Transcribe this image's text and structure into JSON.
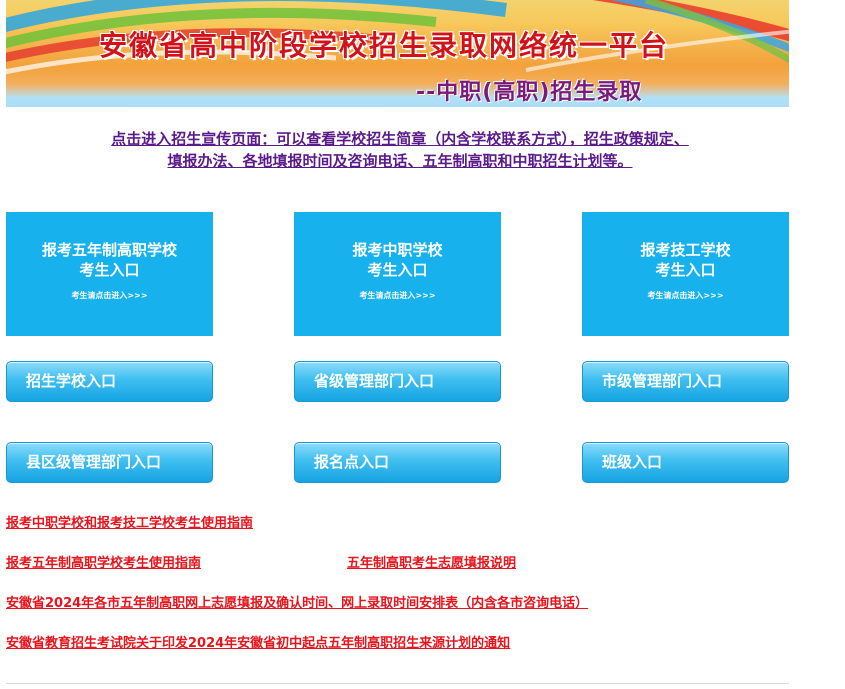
{
  "banner": {
    "title": "安徽省高中阶段学校招生录取网络统一平台",
    "subtitle": "--中职(高职)招生录取"
  },
  "promo": {
    "line1": "点击进入招生宣传页面：可以查看学校招生简章（内含学校联系方式），招生政策规定、",
    "line2": "填报办法、各地填报时间及咨询电话、五年制高职和中职招生计划等。"
  },
  "entries": [
    {
      "line1": "报考五年制高职学校",
      "line2": "考生入口",
      "hint": "考生请点击进入>>>"
    },
    {
      "line1": "报考中职学校",
      "line2": "考生入口",
      "hint": "考生请点击进入>>>"
    },
    {
      "line1": "报考技工学校",
      "line2": "考生入口",
      "hint": "考生请点击进入>>>"
    }
  ],
  "buttons": [
    "招生学校入口",
    "省级管理部门入口",
    "市级管理部门入口",
    "县区级管理部门入口",
    "报名点入口",
    "班级入口"
  ],
  "links": [
    "报考中职学校和报考技工学校考生使用指南",
    "报考五年制高职学校考生使用指南",
    "五年制高职考生志愿填报说明",
    "安徽省2024年各市五年制高职网上志愿填报及确认时间、网上录取时间安排表（内含各市咨询电话）",
    "安徽省教育招生考试院关于印发2024年安徽省初中起点五年制高职招生来源计划的通知"
  ],
  "colors": {
    "entry_bg": "#17b2ee",
    "link_red": "#e8131b",
    "promo_purple": "#5b1a8a",
    "title_red": "#d1121a"
  }
}
